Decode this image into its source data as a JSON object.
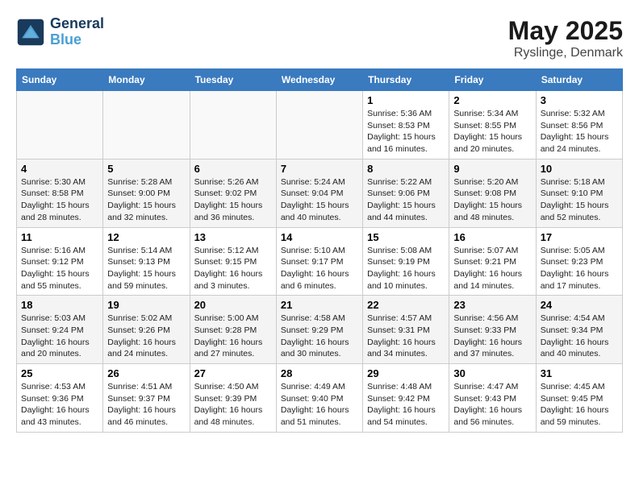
{
  "header": {
    "logo_line1": "General",
    "logo_line2": "Blue",
    "title": "May 2025",
    "subtitle": "Ryslinge, Denmark"
  },
  "weekdays": [
    "Sunday",
    "Monday",
    "Tuesday",
    "Wednesday",
    "Thursday",
    "Friday",
    "Saturday"
  ],
  "weeks": [
    [
      {
        "day": "",
        "sunrise": "",
        "sunset": "",
        "daylight": ""
      },
      {
        "day": "",
        "sunrise": "",
        "sunset": "",
        "daylight": ""
      },
      {
        "day": "",
        "sunrise": "",
        "sunset": "",
        "daylight": ""
      },
      {
        "day": "",
        "sunrise": "",
        "sunset": "",
        "daylight": ""
      },
      {
        "day": "1",
        "sunrise": "5:36 AM",
        "sunset": "8:53 PM",
        "daylight": "15 hours and 16 minutes."
      },
      {
        "day": "2",
        "sunrise": "5:34 AM",
        "sunset": "8:55 PM",
        "daylight": "15 hours and 20 minutes."
      },
      {
        "day": "3",
        "sunrise": "5:32 AM",
        "sunset": "8:56 PM",
        "daylight": "15 hours and 24 minutes."
      }
    ],
    [
      {
        "day": "4",
        "sunrise": "5:30 AM",
        "sunset": "8:58 PM",
        "daylight": "15 hours and 28 minutes."
      },
      {
        "day": "5",
        "sunrise": "5:28 AM",
        "sunset": "9:00 PM",
        "daylight": "15 hours and 32 minutes."
      },
      {
        "day": "6",
        "sunrise": "5:26 AM",
        "sunset": "9:02 PM",
        "daylight": "15 hours and 36 minutes."
      },
      {
        "day": "7",
        "sunrise": "5:24 AM",
        "sunset": "9:04 PM",
        "daylight": "15 hours and 40 minutes."
      },
      {
        "day": "8",
        "sunrise": "5:22 AM",
        "sunset": "9:06 PM",
        "daylight": "15 hours and 44 minutes."
      },
      {
        "day": "9",
        "sunrise": "5:20 AM",
        "sunset": "9:08 PM",
        "daylight": "15 hours and 48 minutes."
      },
      {
        "day": "10",
        "sunrise": "5:18 AM",
        "sunset": "9:10 PM",
        "daylight": "15 hours and 52 minutes."
      }
    ],
    [
      {
        "day": "11",
        "sunrise": "5:16 AM",
        "sunset": "9:12 PM",
        "daylight": "15 hours and 55 minutes."
      },
      {
        "day": "12",
        "sunrise": "5:14 AM",
        "sunset": "9:13 PM",
        "daylight": "15 hours and 59 minutes."
      },
      {
        "day": "13",
        "sunrise": "5:12 AM",
        "sunset": "9:15 PM",
        "daylight": "16 hours and 3 minutes."
      },
      {
        "day": "14",
        "sunrise": "5:10 AM",
        "sunset": "9:17 PM",
        "daylight": "16 hours and 6 minutes."
      },
      {
        "day": "15",
        "sunrise": "5:08 AM",
        "sunset": "9:19 PM",
        "daylight": "16 hours and 10 minutes."
      },
      {
        "day": "16",
        "sunrise": "5:07 AM",
        "sunset": "9:21 PM",
        "daylight": "16 hours and 14 minutes."
      },
      {
        "day": "17",
        "sunrise": "5:05 AM",
        "sunset": "9:23 PM",
        "daylight": "16 hours and 17 minutes."
      }
    ],
    [
      {
        "day": "18",
        "sunrise": "5:03 AM",
        "sunset": "9:24 PM",
        "daylight": "16 hours and 20 minutes."
      },
      {
        "day": "19",
        "sunrise": "5:02 AM",
        "sunset": "9:26 PM",
        "daylight": "16 hours and 24 minutes."
      },
      {
        "day": "20",
        "sunrise": "5:00 AM",
        "sunset": "9:28 PM",
        "daylight": "16 hours and 27 minutes."
      },
      {
        "day": "21",
        "sunrise": "4:58 AM",
        "sunset": "9:29 PM",
        "daylight": "16 hours and 30 minutes."
      },
      {
        "day": "22",
        "sunrise": "4:57 AM",
        "sunset": "9:31 PM",
        "daylight": "16 hours and 34 minutes."
      },
      {
        "day": "23",
        "sunrise": "4:56 AM",
        "sunset": "9:33 PM",
        "daylight": "16 hours and 37 minutes."
      },
      {
        "day": "24",
        "sunrise": "4:54 AM",
        "sunset": "9:34 PM",
        "daylight": "16 hours and 40 minutes."
      }
    ],
    [
      {
        "day": "25",
        "sunrise": "4:53 AM",
        "sunset": "9:36 PM",
        "daylight": "16 hours and 43 minutes."
      },
      {
        "day": "26",
        "sunrise": "4:51 AM",
        "sunset": "9:37 PM",
        "daylight": "16 hours and 46 minutes."
      },
      {
        "day": "27",
        "sunrise": "4:50 AM",
        "sunset": "9:39 PM",
        "daylight": "16 hours and 48 minutes."
      },
      {
        "day": "28",
        "sunrise": "4:49 AM",
        "sunset": "9:40 PM",
        "daylight": "16 hours and 51 minutes."
      },
      {
        "day": "29",
        "sunrise": "4:48 AM",
        "sunset": "9:42 PM",
        "daylight": "16 hours and 54 minutes."
      },
      {
        "day": "30",
        "sunrise": "4:47 AM",
        "sunset": "9:43 PM",
        "daylight": "16 hours and 56 minutes."
      },
      {
        "day": "31",
        "sunrise": "4:45 AM",
        "sunset": "9:45 PM",
        "daylight": "16 hours and 59 minutes."
      }
    ]
  ]
}
